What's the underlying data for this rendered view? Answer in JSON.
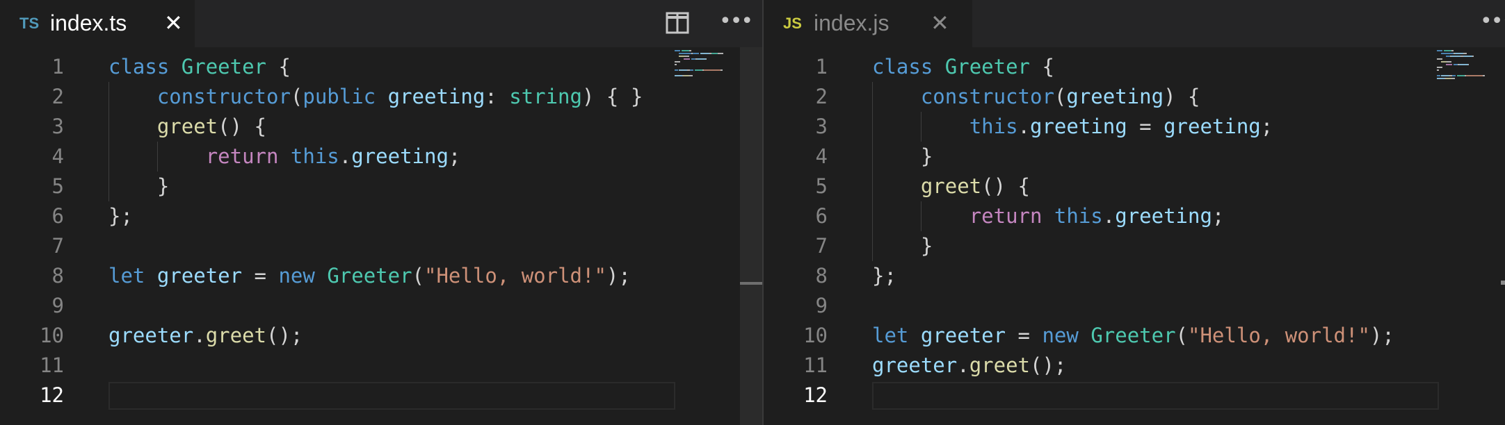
{
  "colors": {
    "editor_background": "#1e1e1e",
    "tab_bar_background": "#252526",
    "line_number": "#858585",
    "line_number_active": "#ffffff",
    "ts_icon": "#519aba",
    "js_icon": "#cbcb41",
    "token_colors": {
      "kw": "#569cd6",
      "cls": "#4ec9b0",
      "fn": "#dcdcaa",
      "var": "#9cdcfe",
      "str": "#ce9178",
      "ctl": "#c586c0",
      "pun": "#d4d4d4"
    }
  },
  "left_pane": {
    "tab": {
      "icon_label": "TS",
      "title": "index.ts",
      "close_glyph": "✕",
      "active": true
    },
    "actions": {
      "split_icon": "split-editor-icon",
      "more_icon": "more-actions-icon",
      "more_glyph": "•••"
    },
    "active_line": 12,
    "lines": [
      {
        "number": "1",
        "tokens": [
          {
            "t": "class",
            "c": "kw"
          },
          {
            "t": " ",
            "c": "pun"
          },
          {
            "t": "Greeter",
            "c": "cls"
          },
          {
            "t": " {",
            "c": "pun"
          }
        ]
      },
      {
        "number": "2",
        "tokens": [
          {
            "t": "    ",
            "c": "pun"
          },
          {
            "t": "constructor",
            "c": "kw"
          },
          {
            "t": "(",
            "c": "pun"
          },
          {
            "t": "public",
            "c": "kw"
          },
          {
            "t": " ",
            "c": "pun"
          },
          {
            "t": "greeting",
            "c": "var"
          },
          {
            "t": ": ",
            "c": "pun"
          },
          {
            "t": "string",
            "c": "cls"
          },
          {
            "t": ") { }",
            "c": "pun"
          }
        ]
      },
      {
        "number": "3",
        "tokens": [
          {
            "t": "    ",
            "c": "pun"
          },
          {
            "t": "greet",
            "c": "fn"
          },
          {
            "t": "() {",
            "c": "pun"
          }
        ]
      },
      {
        "number": "4",
        "tokens": [
          {
            "t": "        ",
            "c": "pun"
          },
          {
            "t": "return",
            "c": "ctl"
          },
          {
            "t": " ",
            "c": "pun"
          },
          {
            "t": "this",
            "c": "kw"
          },
          {
            "t": ".",
            "c": "pun"
          },
          {
            "t": "greeting",
            "c": "var"
          },
          {
            "t": ";",
            "c": "pun"
          }
        ]
      },
      {
        "number": "5",
        "tokens": [
          {
            "t": "    }",
            "c": "pun"
          }
        ]
      },
      {
        "number": "6",
        "tokens": [
          {
            "t": "};",
            "c": "pun"
          }
        ]
      },
      {
        "number": "7",
        "tokens": []
      },
      {
        "number": "8",
        "tokens": [
          {
            "t": "let",
            "c": "kw"
          },
          {
            "t": " ",
            "c": "pun"
          },
          {
            "t": "greeter",
            "c": "var"
          },
          {
            "t": " = ",
            "c": "pun"
          },
          {
            "t": "new",
            "c": "kw"
          },
          {
            "t": " ",
            "c": "pun"
          },
          {
            "t": "Greeter",
            "c": "cls"
          },
          {
            "t": "(",
            "c": "pun"
          },
          {
            "t": "\"Hello, world!\"",
            "c": "str"
          },
          {
            "t": ");",
            "c": "pun"
          }
        ]
      },
      {
        "number": "9",
        "tokens": []
      },
      {
        "number": "10",
        "tokens": [
          {
            "t": "greeter",
            "c": "var"
          },
          {
            "t": ".",
            "c": "pun"
          },
          {
            "t": "greet",
            "c": "fn"
          },
          {
            "t": "();",
            "c": "pun"
          }
        ]
      },
      {
        "number": "11",
        "tokens": []
      },
      {
        "number": "12",
        "tokens": []
      }
    ]
  },
  "right_pane": {
    "tab": {
      "icon_label": "JS",
      "title": "index.js",
      "close_glyph": "✕",
      "active": false
    },
    "actions": {
      "more_icon": "more-actions-icon",
      "more_glyph": "•••"
    },
    "active_line": 12,
    "lines": [
      {
        "number": "1",
        "tokens": [
          {
            "t": "class",
            "c": "kw"
          },
          {
            "t": " ",
            "c": "pun"
          },
          {
            "t": "Greeter",
            "c": "cls"
          },
          {
            "t": " {",
            "c": "pun"
          }
        ]
      },
      {
        "number": "2",
        "tokens": [
          {
            "t": "    ",
            "c": "pun"
          },
          {
            "t": "constructor",
            "c": "kw"
          },
          {
            "t": "(",
            "c": "pun"
          },
          {
            "t": "greeting",
            "c": "var"
          },
          {
            "t": ") {",
            "c": "pun"
          }
        ]
      },
      {
        "number": "3",
        "tokens": [
          {
            "t": "        ",
            "c": "pun"
          },
          {
            "t": "this",
            "c": "kw"
          },
          {
            "t": ".",
            "c": "pun"
          },
          {
            "t": "greeting",
            "c": "var"
          },
          {
            "t": " = ",
            "c": "pun"
          },
          {
            "t": "greeting",
            "c": "var"
          },
          {
            "t": ";",
            "c": "pun"
          }
        ]
      },
      {
        "number": "4",
        "tokens": [
          {
            "t": "    }",
            "c": "pun"
          }
        ]
      },
      {
        "number": "5",
        "tokens": [
          {
            "t": "    ",
            "c": "pun"
          },
          {
            "t": "greet",
            "c": "fn"
          },
          {
            "t": "() {",
            "c": "pun"
          }
        ]
      },
      {
        "number": "6",
        "tokens": [
          {
            "t": "        ",
            "c": "pun"
          },
          {
            "t": "return",
            "c": "ctl"
          },
          {
            "t": " ",
            "c": "pun"
          },
          {
            "t": "this",
            "c": "kw"
          },
          {
            "t": ".",
            "c": "pun"
          },
          {
            "t": "greeting",
            "c": "var"
          },
          {
            "t": ";",
            "c": "pun"
          }
        ]
      },
      {
        "number": "7",
        "tokens": [
          {
            "t": "    }",
            "c": "pun"
          }
        ]
      },
      {
        "number": "8",
        "tokens": [
          {
            "t": "};",
            "c": "pun"
          }
        ]
      },
      {
        "number": "9",
        "tokens": []
      },
      {
        "number": "10",
        "tokens": [
          {
            "t": "let",
            "c": "kw"
          },
          {
            "t": " ",
            "c": "pun"
          },
          {
            "t": "greeter",
            "c": "var"
          },
          {
            "t": " = ",
            "c": "pun"
          },
          {
            "t": "new",
            "c": "kw"
          },
          {
            "t": " ",
            "c": "pun"
          },
          {
            "t": "Greeter",
            "c": "cls"
          },
          {
            "t": "(",
            "c": "pun"
          },
          {
            "t": "\"Hello, world!\"",
            "c": "str"
          },
          {
            "t": ");",
            "c": "pun"
          }
        ]
      },
      {
        "number": "11",
        "tokens": [
          {
            "t": "greeter",
            "c": "var"
          },
          {
            "t": ".",
            "c": "pun"
          },
          {
            "t": "greet",
            "c": "fn"
          },
          {
            "t": "();",
            "c": "pun"
          }
        ]
      },
      {
        "number": "12",
        "tokens": []
      }
    ]
  }
}
